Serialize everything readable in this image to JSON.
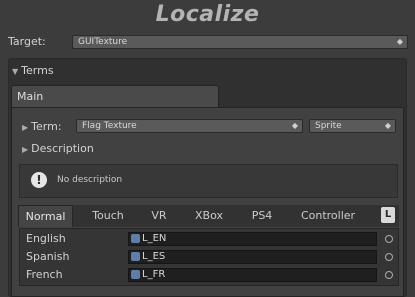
{
  "title": "Localize",
  "target": {
    "label": "Target:",
    "value": "GUITexture"
  },
  "terms": {
    "header": "Terms",
    "main_tab": "Main",
    "term_label": "Term:",
    "term_value": "Flag Texture",
    "type_value": "Sprite",
    "description_label": "Description",
    "description_text": "No description",
    "platform_tabs": [
      "Normal",
      "Touch",
      "VR",
      "XBox",
      "PS4",
      "Controller"
    ],
    "active_tab": "Normal",
    "l_button": "L",
    "translations": [
      {
        "language": "English",
        "value": "L_EN"
      },
      {
        "language": "Spanish",
        "value": "L_ES"
      },
      {
        "language": "French",
        "value": "L_FR"
      }
    ]
  },
  "colors": {
    "background": "#3c3c3c",
    "panel": "#414141",
    "field": "#1f1f1f"
  }
}
